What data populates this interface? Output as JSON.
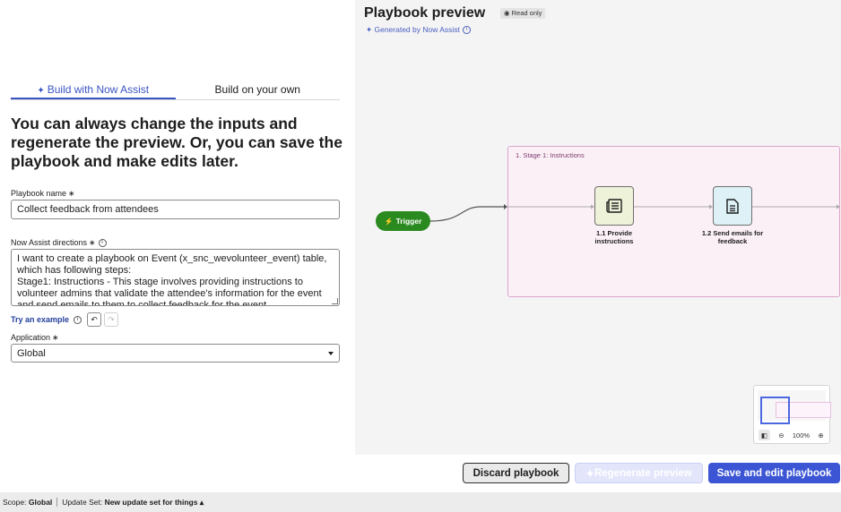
{
  "builder": {
    "tabs": [
      {
        "label": "Build with Now Assist",
        "active": true
      },
      {
        "label": "Build on your own",
        "active": false
      }
    ],
    "headline": "You can always change the inputs and regenerate the preview. Or, you can save the playbook and make edits later.",
    "playbook_name_label": "Playbook name",
    "playbook_name_value": "Collect feedback from attendees",
    "directions_label": "Now Assist directions",
    "directions_text": "I want to create a playbook on Event (x_snc_wevolunteer_event) table, which has following steps:\nStage1: Instructions - This stage involves providing instructions to volunteer admins that validate the attendee's information for the event and send emails to them to collect feedback for the event",
    "try_example_label": "Try an example",
    "application_label": "Application",
    "application_value": "Global",
    "required_mark": "∗"
  },
  "preview": {
    "title": "Playbook preview",
    "read_only_label": "Read only",
    "generated_label": "Generated by Now Assist",
    "stage_label": "1. Stage 1: Instructions",
    "trigger_label": "Trigger",
    "nodes": [
      {
        "label": "1.1 Provide instructions",
        "icon": "news-icon"
      },
      {
        "label": "1.2 Send emails for feedback",
        "icon": "document-icon"
      }
    ],
    "zoom_level": "100%"
  },
  "actions": {
    "discard_label": "Discard playbook",
    "regenerate_label": "Regenerate preview",
    "save_label": "Save and edit playbook"
  },
  "status_bar": {
    "scope_label": "Scope:",
    "scope_value": "Global",
    "update_set_label": "Update Set:",
    "update_set_value": "New update set for things ▴"
  },
  "colors": {
    "accent": "#3b55d4",
    "trigger": "#2a8a1f",
    "stage_bg": "#fcf0f7"
  }
}
